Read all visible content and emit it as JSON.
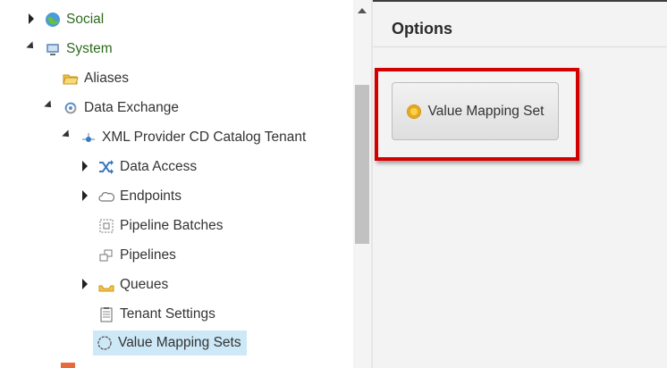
{
  "tree": {
    "items": [
      {
        "label": "Social",
        "icon": "globe-icon"
      },
      {
        "label": "System",
        "icon": "system-icon"
      },
      {
        "label": "Aliases",
        "icon": "folder-icon"
      },
      {
        "label": "Data Exchange",
        "icon": "data-exchange-icon"
      },
      {
        "label": "XML Provider CD Catalog Tenant",
        "icon": "tenant-icon"
      },
      {
        "label": "Data Access",
        "icon": "shuffle-icon"
      },
      {
        "label": "Endpoints",
        "icon": "cloud-icon"
      },
      {
        "label": "Pipeline Batches",
        "icon": "batch-icon"
      },
      {
        "label": "Pipelines",
        "icon": "pipelines-icon"
      },
      {
        "label": "Queues",
        "icon": "tray-icon"
      },
      {
        "label": "Tenant Settings",
        "icon": "document-icon"
      },
      {
        "label": "Value Mapping Sets",
        "icon": "ring-icon"
      }
    ]
  },
  "options": {
    "title": "Options",
    "button_label": "Value Mapping Set"
  },
  "colors": {
    "selection": "#cde8f6",
    "highlight_border": "#d40000",
    "top_level_text": "#2e6b1f"
  }
}
